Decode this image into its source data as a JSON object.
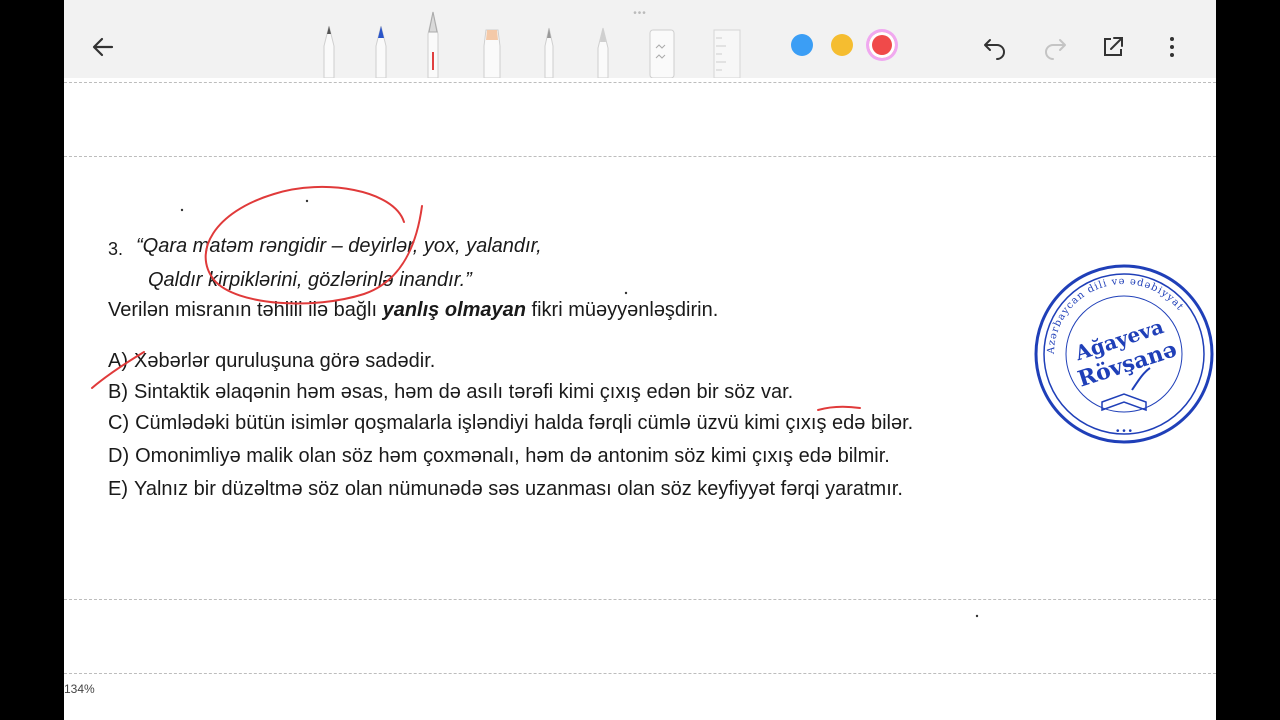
{
  "toolbar": {
    "back_icon": "arrow-left-icon",
    "tools": [
      "pencil-icon",
      "ballpoint-pen-icon",
      "fountain-pen-icon",
      "highlighter-icon",
      "brush-icon",
      "calligraphy-pen-icon",
      "eraser-icon",
      "ruler-icon"
    ],
    "colors": [
      "#3b9ef5",
      "#f5bd30",
      "#f04a4a"
    ],
    "undo_icon": "undo-icon",
    "redo_icon": "redo-icon",
    "share_icon": "share-icon",
    "more_icon": "more-vertical-icon"
  },
  "question": {
    "number": "3.",
    "line1": "“Qara matəm rəngidir – deyirlər, yox, yalandır,",
    "line2": "Qaldır kirpiklərini, gözlərinlə inandır.”",
    "prompt_before": "Verilən misranın təhlili ilə bağlı ",
    "prompt_bold": "yanlış olmayan",
    "prompt_after": " fikri müəyyənləşdirin."
  },
  "options": [
    {
      "letter": "A)",
      "text": "Xəbərlər quruluşuna görə sadədir."
    },
    {
      "letter": "B)",
      "text": "Sintaktik əlaqənin həm əsas, həm də asılı tərəfi kimi çıxış edən bir söz var."
    },
    {
      "letter": "C)",
      "text": "Cümlədəki bütün isimlər qoşmalarla işləndiyi halda fərqli cümlə üzvü kimi çıxış edə bilər."
    },
    {
      "letter": "D)",
      "text": "Omonimliyə malik olan söz həm çoxmənalı, həm də antonim söz kimi çıxış edə bilmir."
    },
    {
      "letter": "E)",
      "text": "Yalnız bir düzəltmə söz olan nümunədə  səs uzanması olan söz keyfiyyət fərqi yaratmır."
    }
  ],
  "stamp": {
    "arc_text": "Azərbaycan dili və ədəbiyyat",
    "name_line1": "Ağayeva",
    "name_line2": "Rövşanə",
    "color": "#1f3fb8"
  },
  "annotation_color": "#e03a3a",
  "zoom": "134%"
}
